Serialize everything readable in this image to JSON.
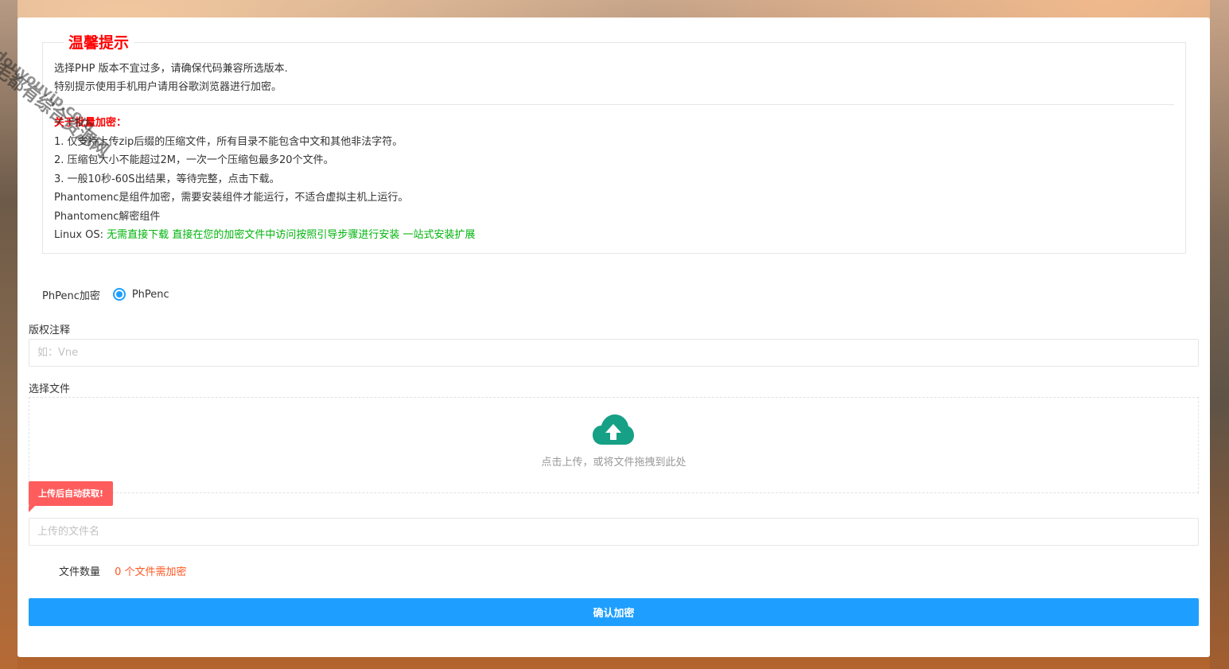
{
  "tips": {
    "title": "温馨提示",
    "line1": "选择PHP 版本不宜过多，请确保代码兼容所选版本.",
    "line2": "特别提示使用手机用户请用谷歌浏览器进行加密。",
    "batch_title": "关于批量加密：",
    "batch_items": [
      "1. 仅支持上传zip后缀的压缩文件，所有目录不能包含中文和其他非法字符。",
      "2. 压缩包大小不能超过2M，一次一个压缩包最多20个文件。",
      "3. 一般10秒-60S出结果，等待完整，点击下载。"
    ],
    "phantom_note": "Phantomenc是组件加密，需要安装组件才能运行，不适合虚拟主机上运行。",
    "phantom_component": "Phantomenc解密组件",
    "linux_label": "Linux OS: ",
    "linux_link1": "无需直接下载",
    "linux_link2": "直接在您的加密文件中访问按照引导步骤进行安装",
    "linux_link3": "一站式安装扩展"
  },
  "encrypt_type": {
    "label": "PhPenc加密",
    "option": "PhPenc"
  },
  "copyright": {
    "label": "版权注释",
    "placeholder": "如：Vne"
  },
  "upload": {
    "label": "选择文件",
    "drop_text": "点击上传，或将文件拖拽到此处",
    "tooltip": "上传后自动获取!",
    "filename_placeholder": "上传的文件名"
  },
  "file_count": {
    "label": "文件数量",
    "value": "0 个文件需加密"
  },
  "submit_label": "确认加密",
  "watermark": {
    "text": "毛都有综合资源网",
    "sub": "douyouvip.com"
  },
  "colors": {
    "accent": "#1e9fff",
    "danger": "#ff0000",
    "success": "#00b40c",
    "warning": "#ff5722",
    "upload_icon": "#16a085"
  }
}
